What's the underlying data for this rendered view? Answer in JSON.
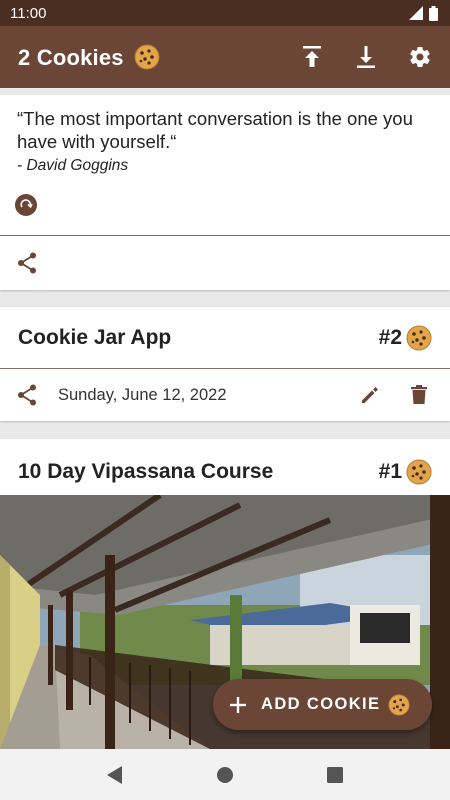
{
  "status_bar": {
    "time": "11:00"
  },
  "app_bar": {
    "title": "2 Cookies",
    "title_icon": "cookie-icon",
    "actions": [
      "upload-icon",
      "download-icon",
      "settings-icon"
    ]
  },
  "quote": {
    "text": "“The most important conversation is the one you have with yourself.“",
    "author": "- David Goggins"
  },
  "cookies": [
    {
      "title": "Cookie Jar App",
      "number": "#2",
      "date": "Sunday, June 12, 2022"
    },
    {
      "title": "10 Day Vipassana Course",
      "number": "#1"
    }
  ],
  "fab": {
    "label": "ADD COOKIE"
  },
  "colors": {
    "primary": "#6b4636",
    "status_bar": "#4a2e21",
    "background": "#e9e9e9"
  }
}
